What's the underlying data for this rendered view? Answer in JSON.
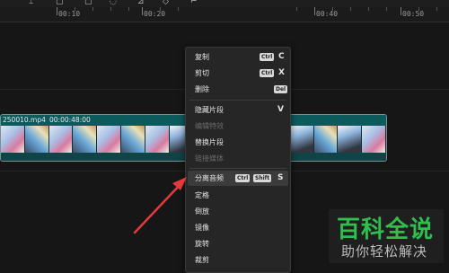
{
  "ruler": {
    "labels": [
      "00:10",
      "00:20",
      "00:40",
      "00:50"
    ]
  },
  "clip": {
    "file_name": "250010.mp4",
    "duration": "00:00:48:00"
  },
  "context_menu": {
    "items": [
      {
        "label": "复制",
        "keys": [
          "Ctrl"
        ],
        "letter": "C",
        "enabled": true
      },
      {
        "label": "剪切",
        "keys": [
          "Ctrl"
        ],
        "letter": "X",
        "enabled": true
      },
      {
        "label": "删除",
        "keys": [
          "Del"
        ],
        "letter": "",
        "enabled": true
      },
      {
        "label": "隐藏片段",
        "keys": [],
        "letter": "V",
        "enabled": true
      },
      {
        "label": "编辑特效",
        "keys": [],
        "letter": "",
        "enabled": false
      },
      {
        "label": "替换片段",
        "keys": [],
        "letter": "",
        "enabled": true
      },
      {
        "label": "链接媒体",
        "keys": [],
        "letter": "",
        "enabled": false
      },
      {
        "label": "分离音频",
        "keys": [
          "Ctrl",
          "Shift"
        ],
        "letter": "S",
        "enabled": true,
        "highlighted": true
      },
      {
        "label": "定格",
        "keys": [],
        "letter": "",
        "enabled": true
      },
      {
        "label": "倒放",
        "keys": [],
        "letter": "",
        "enabled": true
      },
      {
        "label": "镜像",
        "keys": [],
        "letter": "",
        "enabled": true
      },
      {
        "label": "旋转",
        "keys": [],
        "letter": "",
        "enabled": true
      },
      {
        "label": "裁剪",
        "keys": [],
        "letter": "",
        "enabled": true
      }
    ]
  },
  "annotation": {
    "arrow_color": "#e23a3a"
  },
  "watermark": {
    "title": "百科全说",
    "subtitle": "助你轻松解决",
    "color": "#2fbf4e"
  },
  "colors": {
    "background": "#161616",
    "clip_teal": "#0d5a5c",
    "menu_bg": "#262626"
  }
}
